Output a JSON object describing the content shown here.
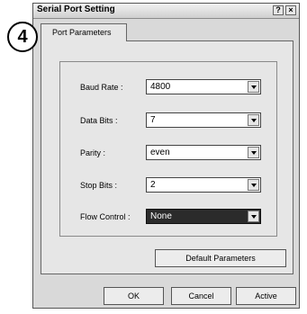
{
  "window": {
    "title": "Serial Port Setting",
    "help_glyph": "?",
    "close_glyph": "×"
  },
  "callout": {
    "label": "4"
  },
  "tabs": [
    {
      "label": "Port Parameters"
    }
  ],
  "fields": [
    {
      "label": "Baud Rate :",
      "value": "4800"
    },
    {
      "label": "Data Bits :",
      "value": "7"
    },
    {
      "label": "Parity :",
      "value": "even"
    },
    {
      "label": "Stop Bits :",
      "value": "2"
    },
    {
      "label": "Flow Control :",
      "value": "None"
    }
  ],
  "buttons": {
    "default_params": "Default Parameters",
    "ok": "OK",
    "cancel": "Cancel",
    "active": "Active"
  }
}
